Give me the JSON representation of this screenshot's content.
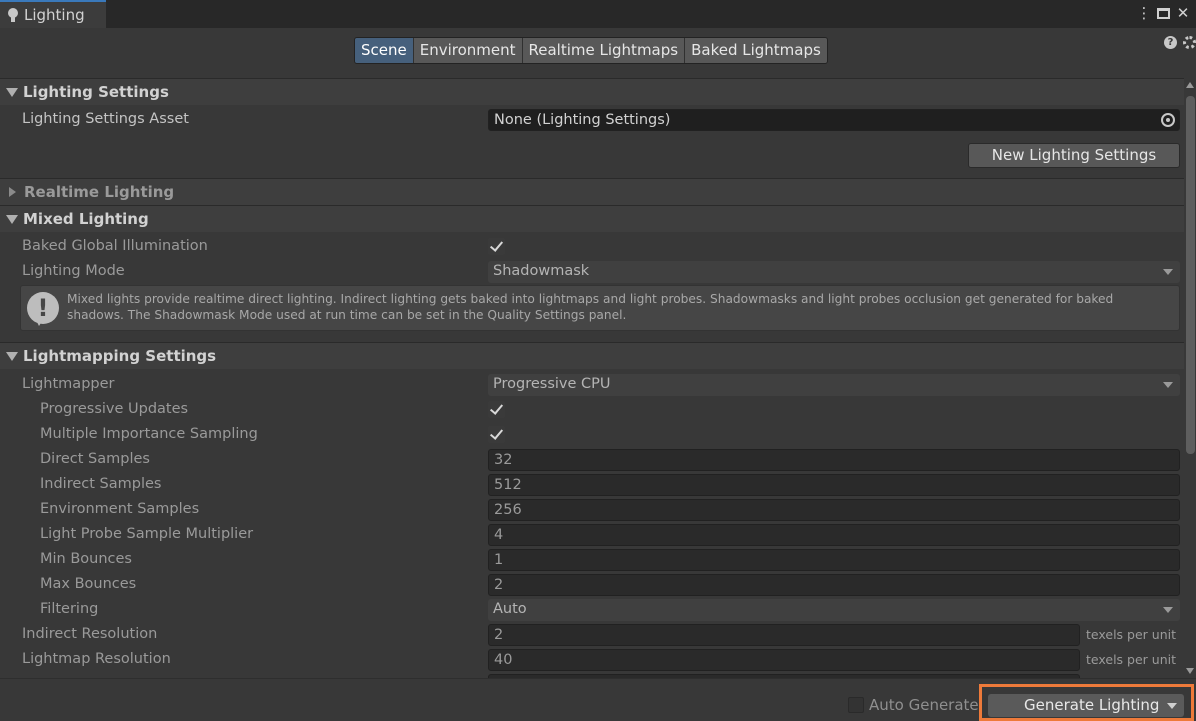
{
  "window": {
    "tab_title": "Lighting",
    "tab_icon": "lightbulb-icon",
    "controls": [
      "more-options-icon",
      "maximize-icon",
      "close-icon"
    ]
  },
  "toolbar": {
    "tabs": [
      "Scene",
      "Environment",
      "Realtime Lightmaps",
      "Baked Lightmaps"
    ],
    "selected_tab": "Scene",
    "icons": [
      "help-icon",
      "settings-icon"
    ]
  },
  "lighting_settings": {
    "header": "Lighting Settings",
    "asset_label": "Lighting Settings Asset",
    "asset_value": "None (Lighting Settings)",
    "new_button": "New Lighting Settings"
  },
  "realtime_lighting": {
    "header": "Realtime Lighting"
  },
  "mixed_lighting": {
    "header": "Mixed Lighting",
    "baked_gi_label": "Baked Global Illumination",
    "baked_gi_checked": true,
    "mode_label": "Lighting Mode",
    "mode_value": "Shadowmask",
    "help_text": "Mixed lights provide realtime direct lighting. Indirect lighting gets baked into lightmaps and light probes. Shadowmasks and light probes occlusion get generated for baked shadows. The Shadowmask Mode used at run time can be set in the Quality Settings panel."
  },
  "lightmapping": {
    "header": "Lightmapping Settings",
    "lightmapper_label": "Lightmapper",
    "lightmapper_value": "Progressive CPU",
    "progressive_updates_label": "Progressive Updates",
    "progressive_updates_checked": true,
    "mis_label": "Multiple Importance Sampling",
    "mis_checked": true,
    "direct_samples_label": "Direct Samples",
    "direct_samples": "32",
    "indirect_samples_label": "Indirect Samples",
    "indirect_samples": "512",
    "environment_samples_label": "Environment Samples",
    "environment_samples": "256",
    "light_probe_multiplier_label": "Light Probe Sample Multiplier",
    "light_probe_multiplier": "4",
    "min_bounces_label": "Min Bounces",
    "min_bounces": "1",
    "max_bounces_label": "Max Bounces",
    "max_bounces": "2",
    "filtering_label": "Filtering",
    "filtering_value": "Auto",
    "indirect_resolution_label": "Indirect Resolution",
    "indirect_resolution": "2",
    "lightmap_resolution_label": "Lightmap Resolution",
    "lightmap_resolution": "40",
    "unit_label": "texels per unit"
  },
  "bottom": {
    "auto_generate_label": "Auto Generate",
    "auto_generate_checked": false,
    "generate_button": "Generate Lighting",
    "highlight_color": "#ee7a3a"
  }
}
